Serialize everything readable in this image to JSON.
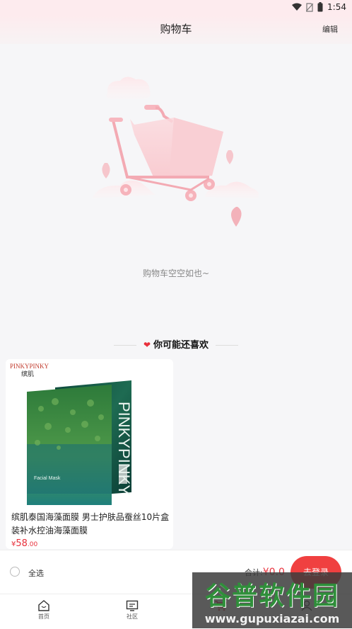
{
  "status_bar": {
    "time": "1:54",
    "icons": [
      "wifi-icon",
      "no-sim-icon",
      "battery-icon"
    ]
  },
  "header": {
    "title": "购物车",
    "edit_label": "编辑"
  },
  "empty_state": {
    "illustration": "empty-cart-illustration",
    "message": "购物车空空如也~"
  },
  "recommend": {
    "title": "你可能还喜欢",
    "products": [
      {
        "brand_logo": "PINKYPINKY",
        "brand_logo_cn": "缤肌",
        "package_text": "PINKYPINKY",
        "package_subtitle": "Facial Mask",
        "name": "缤肌泰国海藻面膜 男士护肤品蚕丝10片盒装补水控油海藻面膜",
        "currency": "¥",
        "price_int": "58",
        "price_dec": ".00"
      }
    ]
  },
  "checkout": {
    "select_all_label": "全选",
    "total_label": "合计:",
    "total_currency": "¥",
    "total_amount": "0",
    "total_suffix": ".0",
    "checkout_button": "去登录"
  },
  "tabbar": {
    "items": [
      {
        "label": "首页",
        "icon": "home-icon"
      },
      {
        "label": "社区",
        "icon": "community-icon"
      },
      {
        "label": "",
        "icon": "cart-icon"
      },
      {
        "label": "",
        "icon": "profile-icon"
      }
    ]
  },
  "watermark": {
    "title": "谷普软件园",
    "url": "www.gupuxiazai.com"
  },
  "colors": {
    "accent": "#e8303b",
    "header_bg": "#fdebee",
    "page_bg": "#f6f6f8",
    "watermark_green": "#2f8f3a"
  }
}
